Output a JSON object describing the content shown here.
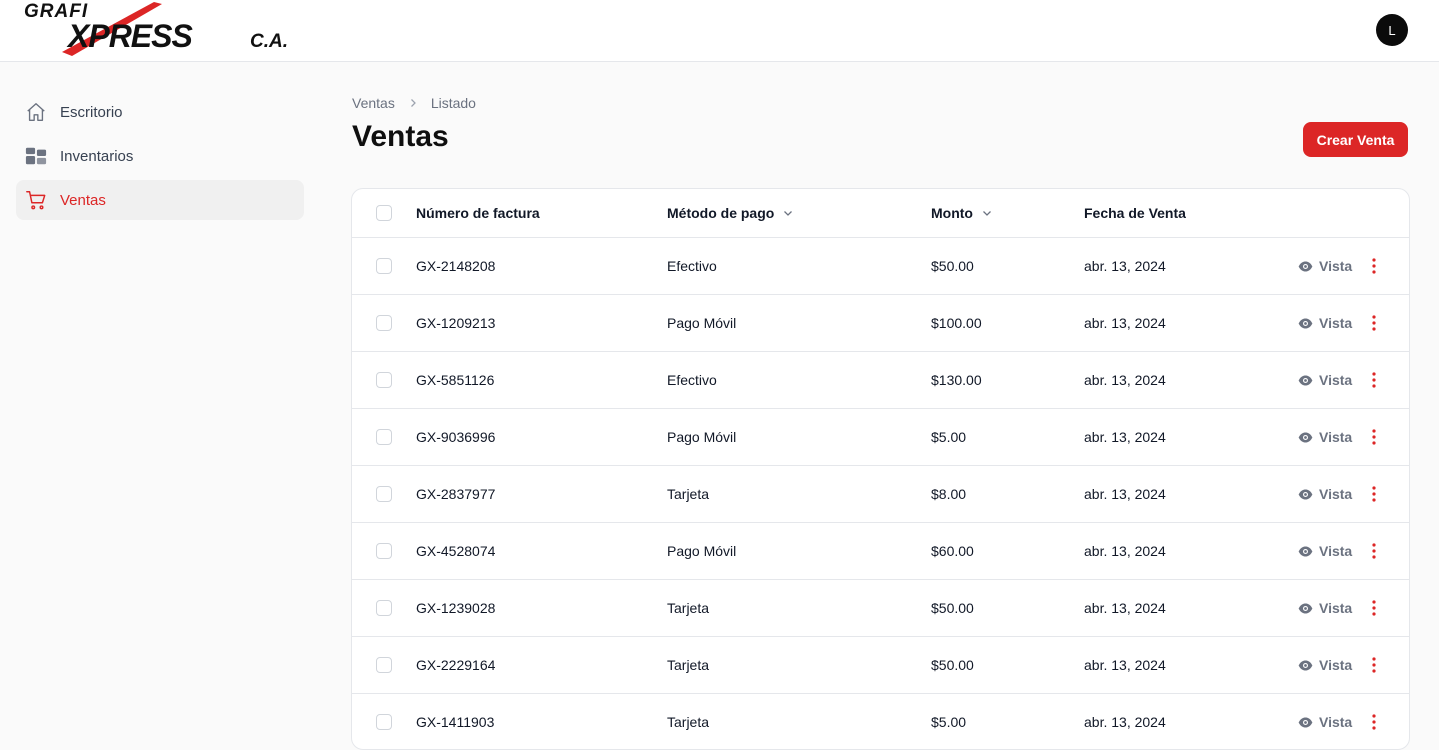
{
  "brand": {
    "logo_top": "GRAFI",
    "logo_main": "XPRESS",
    "logo_suffix": "C.A.",
    "accent": "#dc2626"
  },
  "user": {
    "avatar_initial": "L"
  },
  "sidebar": {
    "items": [
      {
        "label": "Escritorio",
        "icon": "home-icon",
        "active": false
      },
      {
        "label": "Inventarios",
        "icon": "grid-icon",
        "active": false
      },
      {
        "label": "Ventas",
        "icon": "shopping-cart-icon",
        "active": true
      }
    ]
  },
  "breadcrumb": {
    "root": "Ventas",
    "current": "Listado"
  },
  "page": {
    "title": "Ventas",
    "create_button": "Crear Venta"
  },
  "table": {
    "columns": [
      "Número de factura",
      "Método de pago",
      "Monto",
      "Fecha de Venta"
    ],
    "view_label": "Vista",
    "rows": [
      {
        "invoice": "GX-2148208",
        "method": "Efectivo",
        "amount": "$50.00",
        "date": "abr. 13, 2024"
      },
      {
        "invoice": "GX-1209213",
        "method": "Pago Móvil",
        "amount": "$100.00",
        "date": "abr. 13, 2024"
      },
      {
        "invoice": "GX-5851126",
        "method": "Efectivo",
        "amount": "$130.00",
        "date": "abr. 13, 2024"
      },
      {
        "invoice": "GX-9036996",
        "method": "Pago Móvil",
        "amount": "$5.00",
        "date": "abr. 13, 2024"
      },
      {
        "invoice": "GX-2837977",
        "method": "Tarjeta",
        "amount": "$8.00",
        "date": "abr. 13, 2024"
      },
      {
        "invoice": "GX-4528074",
        "method": "Pago Móvil",
        "amount": "$60.00",
        "date": "abr. 13, 2024"
      },
      {
        "invoice": "GX-1239028",
        "method": "Tarjeta",
        "amount": "$50.00",
        "date": "abr. 13, 2024"
      },
      {
        "invoice": "GX-2229164",
        "method": "Tarjeta",
        "amount": "$50.00",
        "date": "abr. 13, 2024"
      },
      {
        "invoice": "GX-1411903",
        "method": "Tarjeta",
        "amount": "$5.00",
        "date": "abr. 13, 2024"
      }
    ]
  }
}
